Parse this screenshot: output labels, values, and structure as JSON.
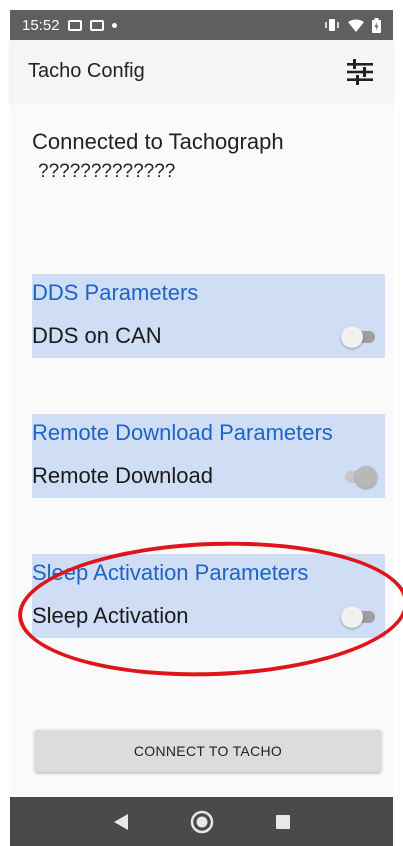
{
  "status_bar": {
    "time": "15:52",
    "icons_left": [
      "mail-icon",
      "calendar-icon",
      "notification-dot-icon"
    ],
    "icons_right": [
      "vibrate-icon",
      "wifi-icon",
      "battery-icon"
    ]
  },
  "app_bar": {
    "title": "Tacho Config",
    "action_icon": "tune-icon"
  },
  "connection": {
    "line1": "Connected to Tachograph",
    "line2": "?????????????"
  },
  "sections": [
    {
      "header": "DDS Parameters",
      "label": "DDS on CAN",
      "switch_on": false
    },
    {
      "header": "Remote Download Parameters",
      "label": "Remote Download",
      "switch_on": true
    },
    {
      "header": "Sleep Activation Parameters",
      "label": "Sleep Activation",
      "switch_on": false
    }
  ],
  "connect_button": {
    "label": "CONNECT TO TACHO"
  },
  "nav_bar": {
    "icons": [
      "back-icon",
      "home-icon",
      "recents-icon"
    ]
  },
  "colors": {
    "section_bg": "#cfddf5",
    "section_header": "#1f63c6",
    "annotation": "#e0151b"
  }
}
